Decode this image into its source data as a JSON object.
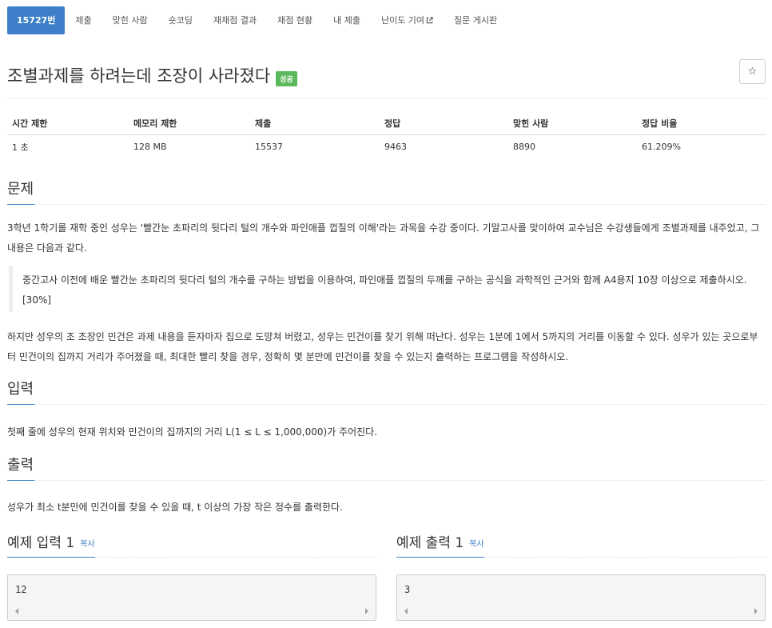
{
  "nav": {
    "tabs": [
      "15727번",
      "제출",
      "맞힌 사람",
      "숏코딩",
      "재채점 결과",
      "채점 현황",
      "내 제출",
      "난이도 기여",
      "질문 게시판"
    ]
  },
  "problem": {
    "title": "조별과제를 하려는데 조장이 사라졌다",
    "status_badge": "성공",
    "star": "☆"
  },
  "info_table": {
    "headers": [
      "시간 제한",
      "메모리 제한",
      "제출",
      "정답",
      "맞힌 사람",
      "정답 비율"
    ],
    "values": [
      "1 초",
      "128 MB",
      "15537",
      "9463",
      "8890",
      "61.209%"
    ]
  },
  "sections": {
    "description_title": "문제",
    "description_p1": "3학년 1학기를 재학 중인 성우는 '빨간눈 초파리의 뒷다리 털의 개수와 파인애플 껍질의 이해'라는 과목을 수강 중이다. 기말고사를 맞이하여 교수님은 수강생들에게 조별과제를 내주었고, 그 내용은 다음과 같다.",
    "description_quote": "중간고사 이전에 배운 빨간눈 초파리의 뒷다리 털의 개수를 구하는 방법을 이용하여, 파인애플 껍질의 두께를 구하는 공식을 과학적인 근거와 함께 A4용지 10장 이상으로 제출하시오. [30%]",
    "description_p2": "하지만 성우의 조 조장인 민건은 과제 내용을 듣자마자 집으로 도망쳐 버렸고, 성우는 민건이를 찾기 위해 떠난다. 성우는 1분에 1에서 5까지의 거리를 이동할 수 있다. 성우가 있는 곳으로부터 민건이의 집까지 거리가 주어졌을 때, 최대한 빨리 찾을 경우, 정확히 몇 분만에 민건이를 찾을 수 있는지 출력하는 프로그램을 작성하시오.",
    "input_title": "입력",
    "input_text": "첫째 줄에 성우의 현재 위치와 민건이의 집까지의 거리 L(1 ≤ L ≤ 1,000,000)가 주어진다.",
    "output_title": "출력",
    "output_text": "성우가 최소 t분만에 민건이를 찾을 수 있을 때, t 이상의 가장 작은 정수를 출력한다."
  },
  "examples": {
    "input_title": "예제 입력 1",
    "output_title": "예제 출력 1",
    "copy_label": "복사",
    "input_value": "12",
    "output_value": "3"
  },
  "colors": {
    "accent": "#3d7fc8",
    "success": "#5cb85c"
  }
}
